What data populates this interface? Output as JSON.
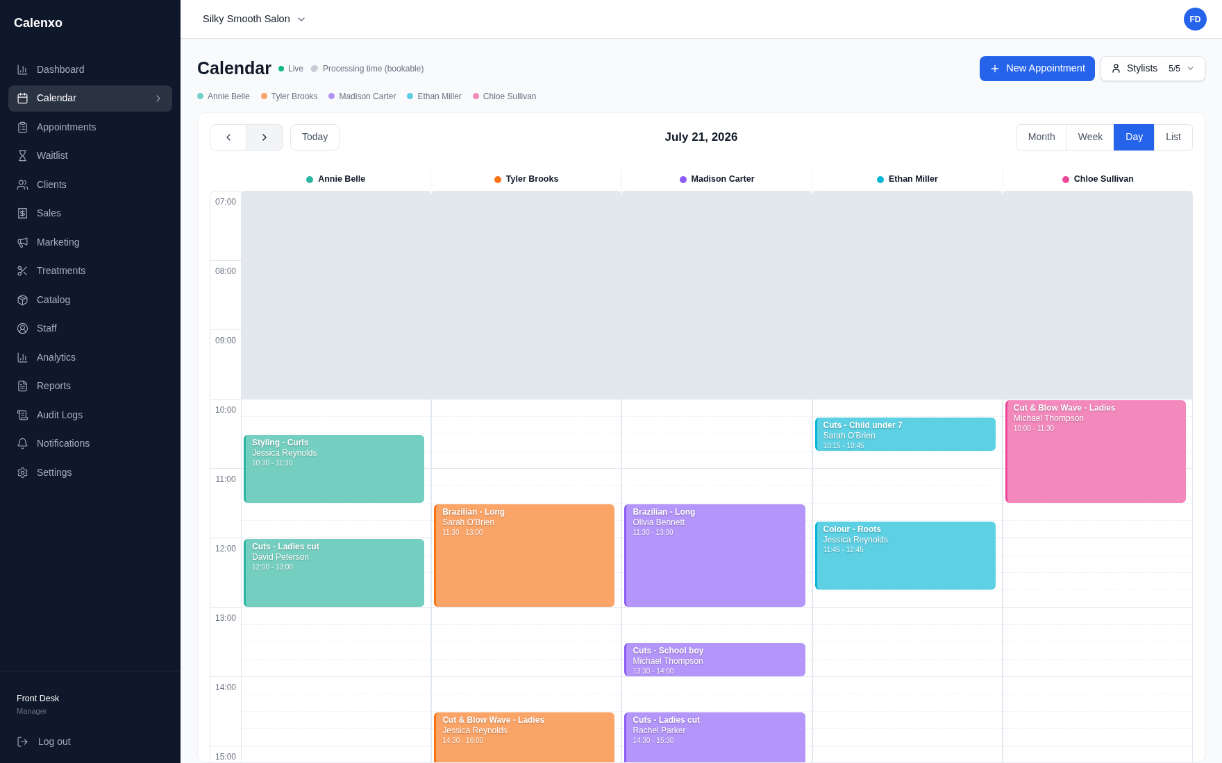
{
  "sidebar": {
    "brand": "Calenxo",
    "items": [
      {
        "label": "Dashboard",
        "selected": false
      },
      {
        "label": "Calendar",
        "selected": true
      },
      {
        "label": "Appointments",
        "selected": false
      },
      {
        "label": "Waitlist",
        "selected": false
      },
      {
        "label": "Clients",
        "selected": false
      },
      {
        "label": "Sales",
        "selected": false
      },
      {
        "label": "Marketing",
        "selected": false
      },
      {
        "label": "Treatments",
        "selected": false
      },
      {
        "label": "Catalog",
        "selected": false
      },
      {
        "label": "Staff",
        "selected": false
      },
      {
        "label": "Analytics",
        "selected": false
      },
      {
        "label": "Reports",
        "selected": false
      },
      {
        "label": "Audit Logs",
        "selected": false
      },
      {
        "label": "Notifications",
        "selected": false
      },
      {
        "label": "Settings",
        "selected": false
      }
    ],
    "user": {
      "name": "Front Desk",
      "role": "Manager"
    },
    "logout": "Log out"
  },
  "header": {
    "salon": "Silky Smooth Salon",
    "avatar": "FD"
  },
  "page": {
    "title": "Calendar",
    "live": "Live",
    "processing": "Processing time (bookable)",
    "new_button": "New Appointment",
    "stylists_button": "Stylists",
    "stylists_count": "5/5"
  },
  "legend": [
    {
      "name": "Annie Belle",
      "color": "#6fd1c4"
    },
    {
      "name": "Tyler Brooks",
      "color": "#f8a266"
    },
    {
      "name": "Madison Carter",
      "color": "#b394f5"
    },
    {
      "name": "Ethan Miller",
      "color": "#5ecde3"
    },
    {
      "name": "Chloe Sullivan",
      "color": "#f18aba"
    }
  ],
  "toolbar": {
    "today": "Today",
    "date": "July 21, 2026",
    "views": [
      {
        "label": "Month",
        "selected": false
      },
      {
        "label": "Week",
        "selected": false
      },
      {
        "label": "Day",
        "selected": true
      },
      {
        "label": "List",
        "selected": false
      }
    ]
  },
  "hours": [
    {
      "label": "07:00",
      "closed": true
    },
    {
      "label": "08:00",
      "closed": true
    },
    {
      "label": "09:00",
      "closed": true
    },
    {
      "label": "10:00",
      "closed": false
    },
    {
      "label": "11:00",
      "closed": false
    },
    {
      "label": "12:00",
      "closed": false
    },
    {
      "label": "13:00",
      "closed": false
    },
    {
      "label": "14:00",
      "closed": false
    },
    {
      "label": "15:00",
      "closed": false
    }
  ],
  "columns": [
    {
      "name": "Annie Belle",
      "color": "#2bb5a0",
      "events": [
        {
          "title": "Styling - Curls",
          "client": "Jessica Reynolds",
          "time": "10:30 - 11:30"
        },
        {
          "title": "Cuts - Ladies cut",
          "client": "David Peterson",
          "time": "12:00 - 13:00"
        }
      ]
    },
    {
      "name": "Tyler Brooks",
      "color": "#f97316",
      "events": [
        {
          "title": "Brazilian - Long",
          "client": "Sarah O'Brien",
          "time": "11:30 - 13:00"
        },
        {
          "title": "Cut & Blow Wave - Ladies",
          "client": "Jessica Reynolds",
          "time": "14:30 - 16:00"
        }
      ]
    },
    {
      "name": "Madison Carter",
      "color": "#8b5cf6",
      "events": [
        {
          "title": "Brazilian - Long",
          "client": "Olivia Bennett",
          "time": "11:30 - 13:00"
        },
        {
          "title": "Cuts - School boy",
          "client": "Michael Thompson",
          "time": "13:30 - 14:00"
        },
        {
          "title": "Cuts - Ladies cut",
          "client": "Rachel Parker",
          "time": "14:30 - 15:30"
        }
      ]
    },
    {
      "name": "Ethan Miller",
      "color": "#06b6d4",
      "events": [
        {
          "title": "Cuts - Child under 7",
          "client": "Sarah O'Brien",
          "time": "10:15 - 10:45"
        },
        {
          "title": "Colour - Roots",
          "client": "Jessica Reynolds",
          "time": "11:45 - 12:45"
        }
      ]
    },
    {
      "name": "Chloe Sullivan",
      "color": "#ec4899",
      "events": [
        {
          "title": "Cut & Blow Wave - Ladies",
          "client": "Michael Thompson",
          "time": "10:00 - 11:30"
        }
      ]
    }
  ]
}
